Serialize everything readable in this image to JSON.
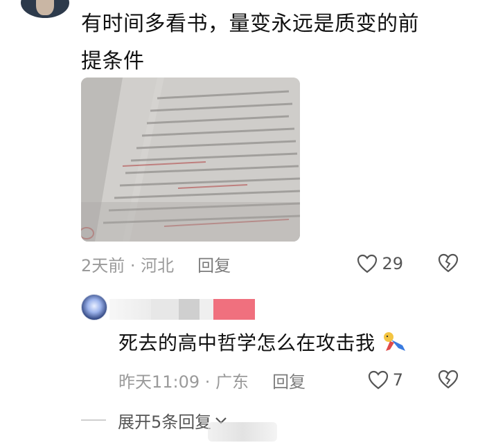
{
  "comment": {
    "text_line1": "有时间多看书，量变永远是质变的前",
    "text_line2": "提条件",
    "time": "2天前",
    "separator": " · ",
    "location": "河北",
    "reply_label": "回复",
    "like_count": "29"
  },
  "reply": {
    "text": "死去的高中哲学怎么在攻击我",
    "time": "昨天11:09",
    "separator": " · ",
    "location": "广东",
    "reply_label": "回复",
    "like_count": "7"
  },
  "expand": {
    "label": "展开5条回复"
  },
  "icons": {
    "like": "heart-outline-icon",
    "dislike": "broken-heart-icon",
    "expand": "chevron-down-icon",
    "emoji": "tumbling-person-emoji"
  },
  "colors": {
    "text": "#111111",
    "meta": "#9a9a9a",
    "mask_pink": "#f0707e"
  }
}
